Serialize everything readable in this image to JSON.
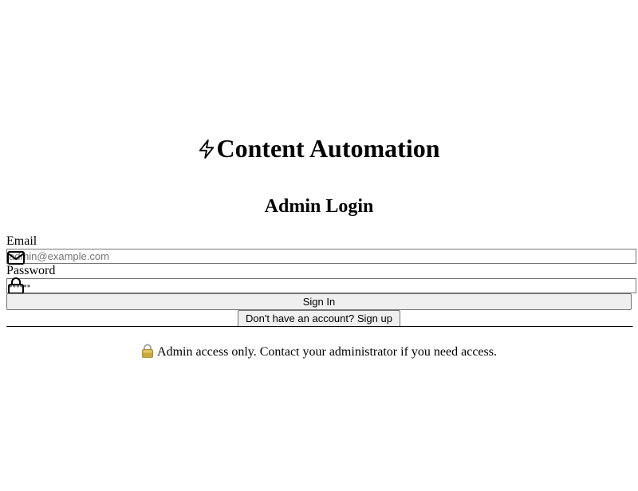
{
  "brand": {
    "title": "Content Automation",
    "icon": "lightning-bolt-icon"
  },
  "login": {
    "heading": "Admin Login",
    "email": {
      "label": "Email",
      "placeholder": "admin@example.com",
      "value": "",
      "icon": "mail-icon"
    },
    "password": {
      "label": "Password",
      "placeholder": "••••••",
      "value": "",
      "icon": "lock-icon"
    },
    "submit_label": "Sign In",
    "signup_label": "Don't have an account? Sign up"
  },
  "notice": {
    "icon": "padlock-emoji-icon",
    "text": "Admin access only. Contact your administrator if you need access."
  },
  "colors": {
    "button_bg": "#efefef",
    "border": "#767676",
    "placeholder": "#757575",
    "text": "#000000",
    "background": "#ffffff"
  }
}
